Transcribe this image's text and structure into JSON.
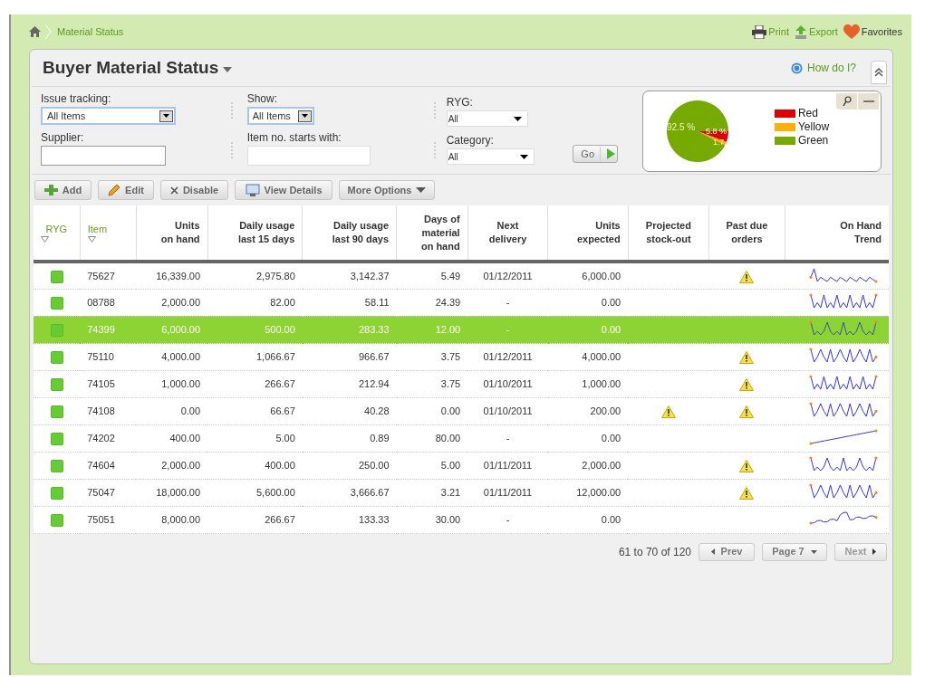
{
  "breadcrumb": {
    "label": "Material Status"
  },
  "top_links": [
    {
      "kind": "print",
      "label": "Print"
    },
    {
      "kind": "export",
      "label": "Export"
    },
    {
      "kind": "favorites",
      "label": "Favorites"
    }
  ],
  "panel": {
    "title": "Buyer Material Status",
    "help": "How do I?"
  },
  "filters": {
    "issue_tracking": {
      "label": "Issue tracking:",
      "value": "All Items"
    },
    "supplier": {
      "label": "Supplier:"
    },
    "show": {
      "label": "Show:",
      "value": "All Items"
    },
    "item_no": {
      "label": "Item no. starts with:"
    },
    "ryg": {
      "label": "RYG:",
      "value": "All"
    },
    "category": {
      "label": "Category:",
      "value": "All"
    },
    "go": "Go"
  },
  "chart": {
    "chart_data": {
      "type": "pie",
      "categories": [
        "Red",
        "Yellow",
        "Green"
      ],
      "values": [
        5.8,
        1.7,
        92.5
      ],
      "colors": [
        "#e00000",
        "#ffb000",
        "#77aa00"
      ],
      "value_labels": [
        "5.8 %",
        "1.7",
        "92.5 %"
      ],
      "legend": true
    }
  },
  "toolbar": [
    {
      "kind": "add",
      "label": "Add"
    },
    {
      "kind": "edit",
      "label": "Edit"
    },
    {
      "kind": "disable",
      "label": "Disable"
    },
    {
      "kind": "details",
      "label": "View Details"
    },
    {
      "kind": "more",
      "label": "More Options"
    }
  ],
  "table": {
    "columns": [
      {
        "label": "RYG",
        "sortable": true
      },
      {
        "label": "Item",
        "sortable": true
      },
      {
        "label": "Units\non hand",
        "sortable": false
      },
      {
        "label": "Daily usage\nlast 15 days",
        "sortable": false
      },
      {
        "label": "Daily usage\nlast 90 days",
        "sortable": false
      },
      {
        "label": "Days of\nmaterial\non hand",
        "sortable": false
      },
      {
        "label": "Next\ndelivery",
        "sortable": false
      },
      {
        "label": "Units\nexpected",
        "sortable": false
      },
      {
        "label": "Projected\nstock-out",
        "sortable": false
      },
      {
        "label": "Past due\norders",
        "sortable": false
      },
      {
        "label": "On Hand\nTrend",
        "sortable": false
      }
    ],
    "rows": [
      {
        "color": "#66cc33",
        "item": "75627",
        "on_hand": "16,339.00",
        "usage_15": "2,975.80",
        "usage_90": "3,142.37",
        "days": "5.49",
        "next_delivery": "01/12/2011",
        "expected": "6,000.00",
        "stockout": false,
        "past_due": true,
        "selected": false
      },
      {
        "color": "#66cc33",
        "item": "08788",
        "on_hand": "2,000.00",
        "usage_15": "82.00",
        "usage_90": "58.11",
        "days": "24.39",
        "next_delivery": "-",
        "expected": "0.00",
        "stockout": false,
        "past_due": false,
        "selected": false
      },
      {
        "color": "#66cc33",
        "item": "74399",
        "on_hand": "6,000.00",
        "usage_15": "500.00",
        "usage_90": "283.33",
        "days": "12.00",
        "next_delivery": "-",
        "expected": "0.00",
        "stockout": false,
        "past_due": false,
        "selected": true
      },
      {
        "color": "#66cc33",
        "item": "75110",
        "on_hand": "4,000.00",
        "usage_15": "1,066.67",
        "usage_90": "966.67",
        "days": "3.75",
        "next_delivery": "01/12/2011",
        "expected": "4,000.00",
        "stockout": false,
        "past_due": true,
        "selected": false
      },
      {
        "color": "#66cc33",
        "item": "74105",
        "on_hand": "1,000.00",
        "usage_15": "266.67",
        "usage_90": "212.94",
        "days": "3.75",
        "next_delivery": "01/10/2011",
        "expected": "1,000.00",
        "stockout": false,
        "past_due": true,
        "selected": false
      },
      {
        "color": "#66cc33",
        "item": "74108",
        "on_hand": "0.00",
        "usage_15": "66.67",
        "usage_90": "40.28",
        "days": "0.00",
        "next_delivery": "01/10/2011",
        "expected": "200.00",
        "stockout": true,
        "past_due": true,
        "selected": false
      },
      {
        "color": "#66cc33",
        "item": "74202",
        "on_hand": "400.00",
        "usage_15": "5.00",
        "usage_90": "0.89",
        "days": "80.00",
        "next_delivery": "-",
        "expected": "0.00",
        "stockout": false,
        "past_due": false,
        "selected": false
      },
      {
        "color": "#66cc33",
        "item": "74604",
        "on_hand": "2,000.00",
        "usage_15": "400.00",
        "usage_90": "250.00",
        "days": "5.00",
        "next_delivery": "01/11/2011",
        "expected": "2,000.00",
        "stockout": false,
        "past_due": true,
        "selected": false
      },
      {
        "color": "#66cc33",
        "item": "75047",
        "on_hand": "18,000.00",
        "usage_15": "5,600.00",
        "usage_90": "3,666.67",
        "days": "3.21",
        "next_delivery": "01/11/2011",
        "expected": "12,000.00",
        "stockout": false,
        "past_due": true,
        "selected": false
      },
      {
        "color": "#66cc33",
        "item": "75051",
        "on_hand": "8,000.00",
        "usage_15": "266.67",
        "usage_90": "133.33",
        "days": "30.00",
        "next_delivery": "-",
        "expected": "0.00",
        "stockout": false,
        "past_due": false,
        "selected": false
      }
    ]
  },
  "pager": {
    "summary": "61 to 70 of 120",
    "prev": "Prev",
    "page": "Page 7",
    "next": "Next"
  }
}
